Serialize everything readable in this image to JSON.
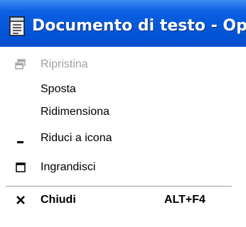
{
  "window": {
    "title": "Documento di testo - Ope",
    "app_icon": "notepad-icon"
  },
  "menu": {
    "items": [
      {
        "label": "Ripristina",
        "icon": "restore-icon",
        "enabled": false
      },
      {
        "label": "Sposta",
        "icon": null,
        "enabled": true
      },
      {
        "label": "Ridimensiona",
        "icon": null,
        "enabled": true
      },
      {
        "label": "Riduci a icona",
        "icon": "minimize-icon",
        "enabled": true
      },
      {
        "label": "Ingrandisci",
        "icon": "maximize-icon",
        "enabled": true
      },
      {
        "label": "Chiudi",
        "icon": "close-icon",
        "enabled": true,
        "bold": true,
        "shortcut": "ALT+F4"
      }
    ]
  },
  "colors": {
    "titlebar": "#0353d6",
    "disabled_text": "#a0a0a0"
  }
}
